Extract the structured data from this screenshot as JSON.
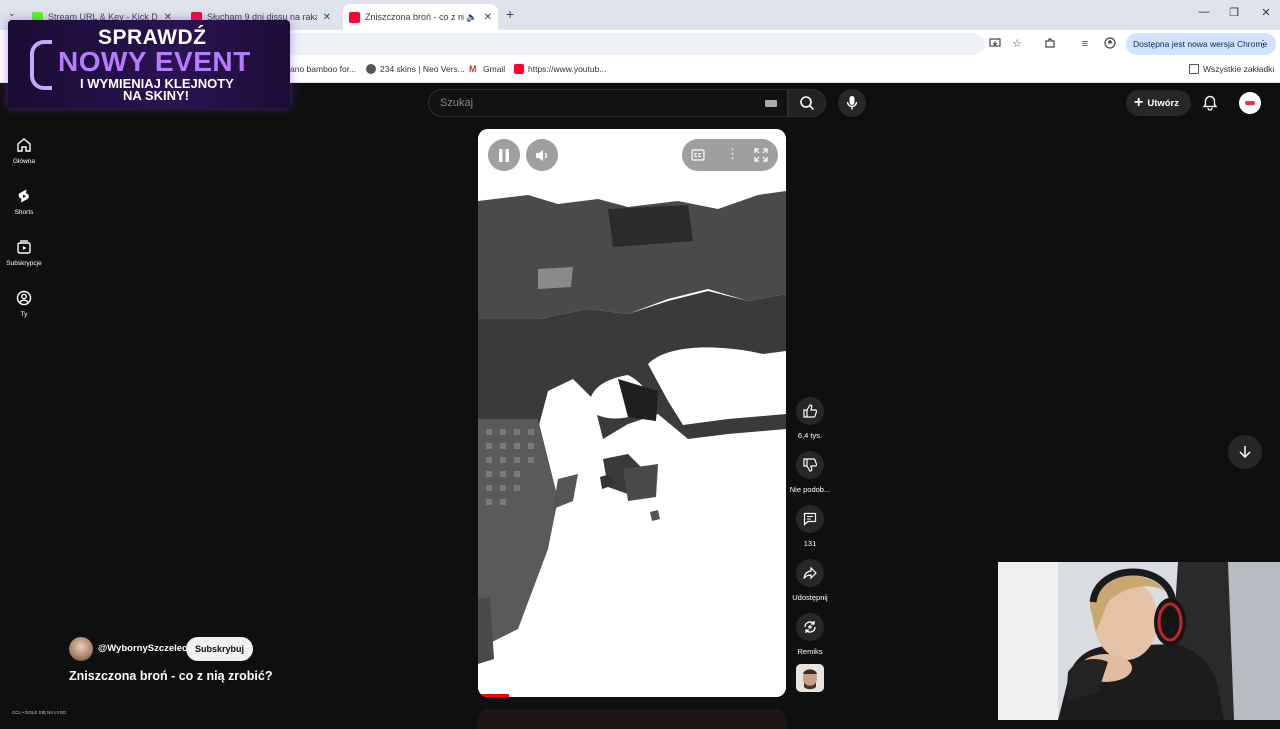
{
  "browser": {
    "tabs": [
      {
        "title": "Stream URL & Key - Kick Dashb",
        "favicon_color": "#53fc18",
        "active": false
      },
      {
        "title": "Słucham 9 dni dissu na raka ze",
        "favicon_color": "#ff0033",
        "active": false
      },
      {
        "title": "Zniszczona broń - co z nią",
        "favicon_color": "#ff0033",
        "active": true
      }
    ],
    "new_tab_symbol": "+",
    "update_text": "Dostępna jest nowa wersja Chrome",
    "bookmarks": [
      {
        "label": "ano bamboo for...",
        "icon": "bookmark-icon"
      },
      {
        "label": "234 skins | Neo Vers...",
        "icon": "globe-icon"
      },
      {
        "label": "Gmail",
        "icon": "gmail-icon"
      },
      {
        "label": "https://www.youtub...",
        "icon": "youtube-icon"
      }
    ],
    "all_bookmarks": "Wszystkie zakładki"
  },
  "overlay": {
    "line1": "SPRAWDŹ",
    "line2": "NOWY EVENT",
    "line3": "I WYMIENIAJ KLEJNOTY",
    "line4": "NA SKINY!"
  },
  "youtube": {
    "search_placeholder": "Szukaj",
    "create_label": "Utwórz",
    "nav": [
      {
        "label": "Główna",
        "icon": "home-icon"
      },
      {
        "label": "Shorts",
        "icon": "shorts-icon"
      },
      {
        "label": "Subskrypcje",
        "icon": "subscriptions-icon"
      },
      {
        "label": "Ty",
        "icon": "user-icon"
      }
    ],
    "actions": {
      "like": "6,4 tys.",
      "dislike": "Nie podob...",
      "comments": "131",
      "share": "Udostępnij",
      "remix": "Remiks"
    },
    "channel": "@WybornySzczelec",
    "subscribe_label": "Subskrybuj",
    "video_title": "Zniszczona broń - co z nią zrobić?",
    "progress": 0.1,
    "corner_text": "CCL • GOLE SIĘ NA LYSO"
  }
}
